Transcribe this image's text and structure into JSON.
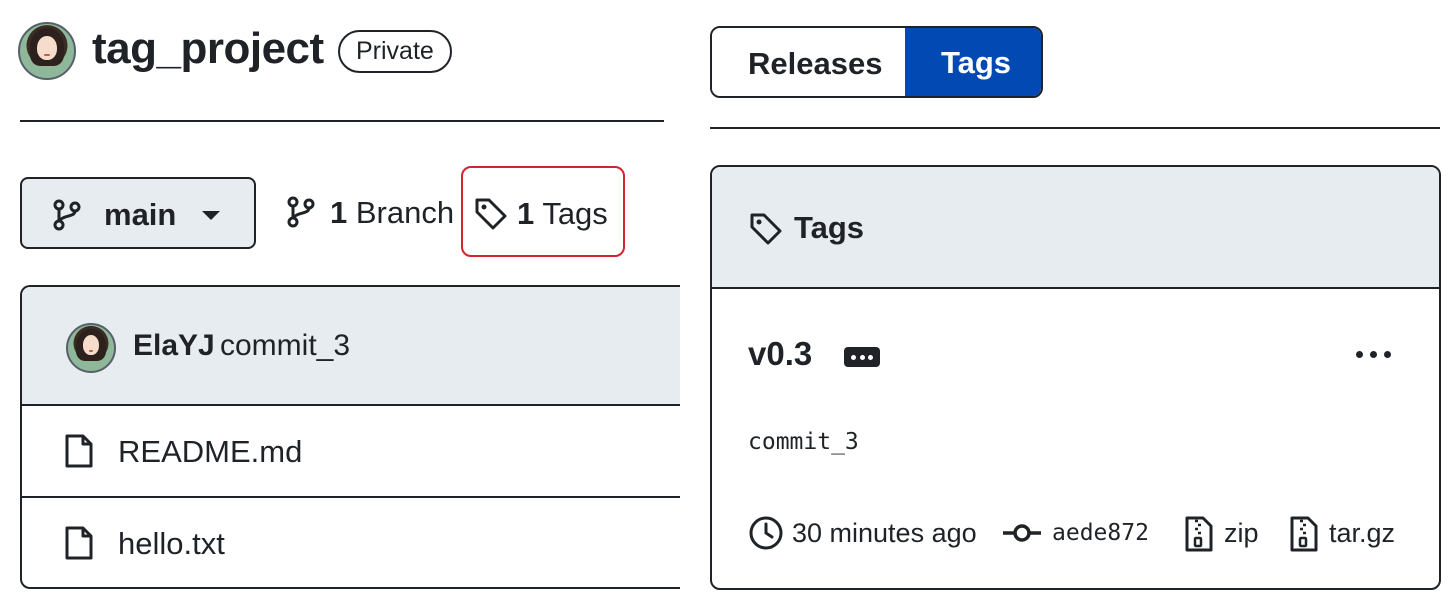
{
  "repo": {
    "name": "tag_project",
    "visibility": "Private"
  },
  "branch_bar": {
    "current_branch": "main",
    "branch_count": "1",
    "branch_label": "Branch",
    "tag_count": "1",
    "tag_label": "Tags"
  },
  "latest_commit": {
    "author": "ElaYJ",
    "message": "commit_3"
  },
  "files": [
    {
      "name": "README.md",
      "icon": "file-icon"
    },
    {
      "name": "hello.txt",
      "icon": "file-icon"
    }
  ],
  "tabs": {
    "releases_label": "Releases",
    "tags_label": "Tags",
    "active": "Tags"
  },
  "tags_panel": {
    "title": "Tags",
    "tags": [
      {
        "name": "v0.3",
        "commit_message": "commit_3",
        "time": "30 minutes ago",
        "sha": "aede872",
        "zip_label": "zip",
        "tar_label": "tar.gz"
      }
    ]
  },
  "colors": {
    "accent_active_tab": "#0349b4",
    "highlight_border": "#d1242f",
    "panel_header_bg": "#e7ecf0",
    "text": "#1f2328"
  }
}
